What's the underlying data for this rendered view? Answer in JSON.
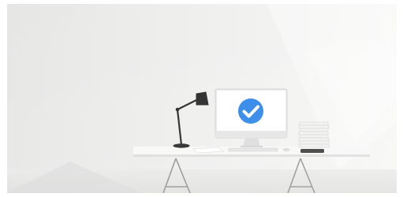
{
  "scene": {
    "description_visible_text": "",
    "colors": {
      "page_background": "#ffffff",
      "wall": "#ececeb",
      "wall_light": "#f4f4f3",
      "floor": "#e3e3e2",
      "desk_top": "#f7f7f6",
      "desk_edge": "#dcdcdb",
      "desk_legs": "#8d8d8d",
      "lamp": "#1b1b1b",
      "monitor_body": "#e8e8e8",
      "monitor_screen": "#ffffff",
      "check_circle": "#1f7ee6",
      "check_mark": "#ffffff",
      "books": "#f1f1f0",
      "phone": "#2b2b2b"
    },
    "icons": {
      "status": "check-circle-icon",
      "lamp": "desk-lamp-icon"
    }
  }
}
